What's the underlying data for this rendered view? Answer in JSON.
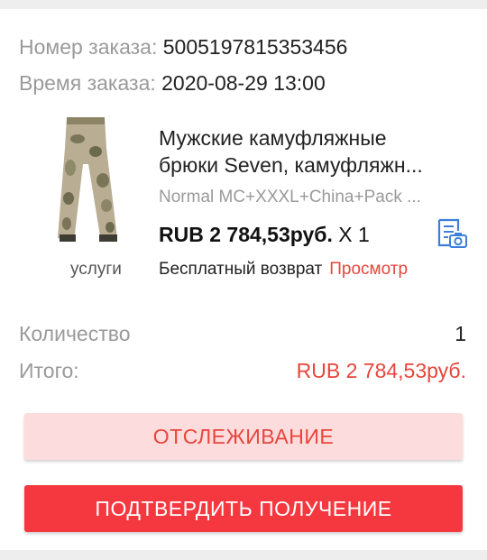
{
  "order": {
    "number_label": "Номер заказа:",
    "number_value": "5005197815353456",
    "time_label": "Время заказа:",
    "time_value": "2020-08-29 13:00"
  },
  "item": {
    "title_line1": "Мужские камуфляжные",
    "title_line2": "брюки Seven, камуфляжн...",
    "variant": "Normal MC+XXXL+China+Pack ...",
    "price": "RUB 2 784,53руб.",
    "quantity": "X 1",
    "service_label": "услуги",
    "return_text": "Бесплатный возврат",
    "view_link": "Просмотр",
    "thumbnail_icon": "camo-pants-image",
    "receipt_icon": "receipt-photo-icon"
  },
  "summary": {
    "quantity_label": "Количество",
    "quantity_value": "1",
    "total_label": "Итого:",
    "total_value": "RUB 2 784,53руб."
  },
  "actions": {
    "track_label": "ОТСЛЕЖИВАНИЕ",
    "confirm_label": "ПОДТВЕРДИТЬ ПОЛУЧЕНИЕ"
  },
  "colors": {
    "accent": "#e8453c",
    "confirm_bg": "#f5383f",
    "track_bg": "#fcdcdc",
    "receipt_icon": "#3b7fd9"
  }
}
